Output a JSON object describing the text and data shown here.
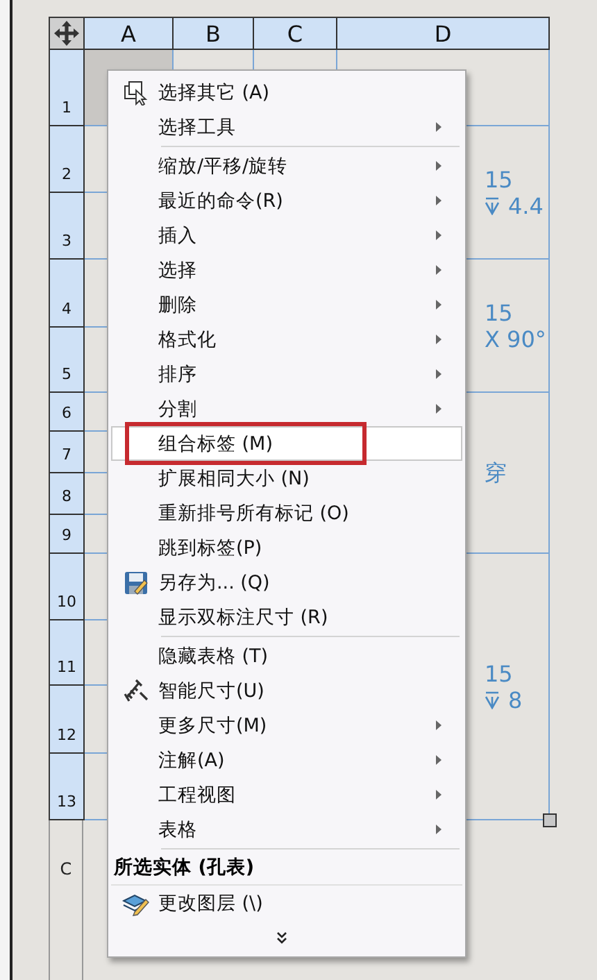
{
  "table": {
    "columns": [
      "A",
      "B",
      "C",
      "D"
    ],
    "rows": [
      {
        "label": "1",
        "selected": true
      },
      {
        "label": "2",
        "selected": false
      },
      {
        "label": "3",
        "selected": false
      },
      {
        "label": "4",
        "selected": false
      },
      {
        "label": "5",
        "selected": false
      },
      {
        "label": "6",
        "selected": false
      },
      {
        "label": "7",
        "selected": false
      },
      {
        "label": "8",
        "selected": false
      },
      {
        "label": "9",
        "selected": false
      },
      {
        "label": "10",
        "selected": false
      },
      {
        "label": "11",
        "selected": false
      },
      {
        "label": "12",
        "selected": false
      },
      {
        "label": "13",
        "selected": false
      }
    ],
    "d_blocks": [
      {
        "lines": [
          {
            "kind": "plain",
            "text": "15"
          },
          {
            "kind": "depth",
            "text": "4.4"
          }
        ]
      },
      {
        "lines": [
          {
            "kind": "plain",
            "text": "15"
          },
          {
            "kind": "plain",
            "text": "X 90°"
          }
        ]
      },
      {
        "lines": [
          {
            "kind": "plain",
            "text": "穿"
          }
        ]
      },
      {
        "lines": [
          {
            "kind": "plain",
            "text": "15"
          },
          {
            "kind": "depth",
            "text": "8"
          }
        ]
      }
    ],
    "below_label": "C"
  },
  "context_menu": {
    "items": [
      {
        "kind": "item",
        "label": "选择其它 (A)",
        "submenu": false,
        "highlighted": false,
        "annotated": false
      },
      {
        "kind": "item",
        "label": "选择工具",
        "submenu": true,
        "highlighted": false,
        "annotated": false
      },
      {
        "kind": "separator"
      },
      {
        "kind": "item",
        "label": "缩放/平移/旋转",
        "submenu": true,
        "highlighted": false,
        "annotated": false
      },
      {
        "kind": "item",
        "label": "最近的命令(R)",
        "submenu": true,
        "highlighted": false,
        "annotated": false
      },
      {
        "kind": "item",
        "label": "插入",
        "submenu": true,
        "highlighted": false,
        "annotated": false
      },
      {
        "kind": "item",
        "label": "选择",
        "submenu": true,
        "highlighted": false,
        "annotated": false
      },
      {
        "kind": "item",
        "label": "删除",
        "submenu": true,
        "highlighted": false,
        "annotated": false
      },
      {
        "kind": "item",
        "label": "格式化",
        "submenu": true,
        "highlighted": false,
        "annotated": false
      },
      {
        "kind": "item",
        "label": "排序",
        "submenu": true,
        "highlighted": false,
        "annotated": false
      },
      {
        "kind": "item",
        "label": "分割",
        "submenu": true,
        "highlighted": false,
        "annotated": false
      },
      {
        "kind": "item",
        "label": "组合标签 (M)",
        "submenu": false,
        "highlighted": true,
        "annotated": true
      },
      {
        "kind": "item",
        "label": "扩展相同大小 (N)",
        "submenu": false,
        "highlighted": false,
        "annotated": false
      },
      {
        "kind": "item",
        "label": "重新排号所有标记 (O)",
        "submenu": false,
        "highlighted": false,
        "annotated": false
      },
      {
        "kind": "item",
        "label": "跳到标签(P)",
        "submenu": false,
        "highlighted": false,
        "annotated": false
      },
      {
        "kind": "item",
        "label": "另存为... (Q)",
        "submenu": false,
        "highlighted": false,
        "annotated": false
      },
      {
        "kind": "item",
        "label": "显示双标注尺寸 (R)",
        "submenu": false,
        "highlighted": false,
        "annotated": false
      },
      {
        "kind": "separator"
      },
      {
        "kind": "item",
        "label": "隐藏表格 (T)",
        "submenu": false,
        "highlighted": false,
        "annotated": false
      },
      {
        "kind": "item",
        "label": "智能尺寸(U)",
        "submenu": false,
        "highlighted": false,
        "annotated": false
      },
      {
        "kind": "item",
        "label": "更多尺寸(M)",
        "submenu": true,
        "highlighted": false,
        "annotated": false
      },
      {
        "kind": "item",
        "label": "注解(A)",
        "submenu": true,
        "highlighted": false,
        "annotated": false
      },
      {
        "kind": "item",
        "label": "工程视图",
        "submenu": true,
        "highlighted": false,
        "annotated": false
      },
      {
        "kind": "item",
        "label": "表格",
        "submenu": true,
        "highlighted": false,
        "annotated": false
      },
      {
        "kind": "separator"
      },
      {
        "kind": "header",
        "label": "所选实体 (孔表)"
      },
      {
        "kind": "item",
        "label": "更改图层 (\\)",
        "submenu": false,
        "highlighted": false,
        "annotated": false
      },
      {
        "kind": "more"
      }
    ]
  }
}
